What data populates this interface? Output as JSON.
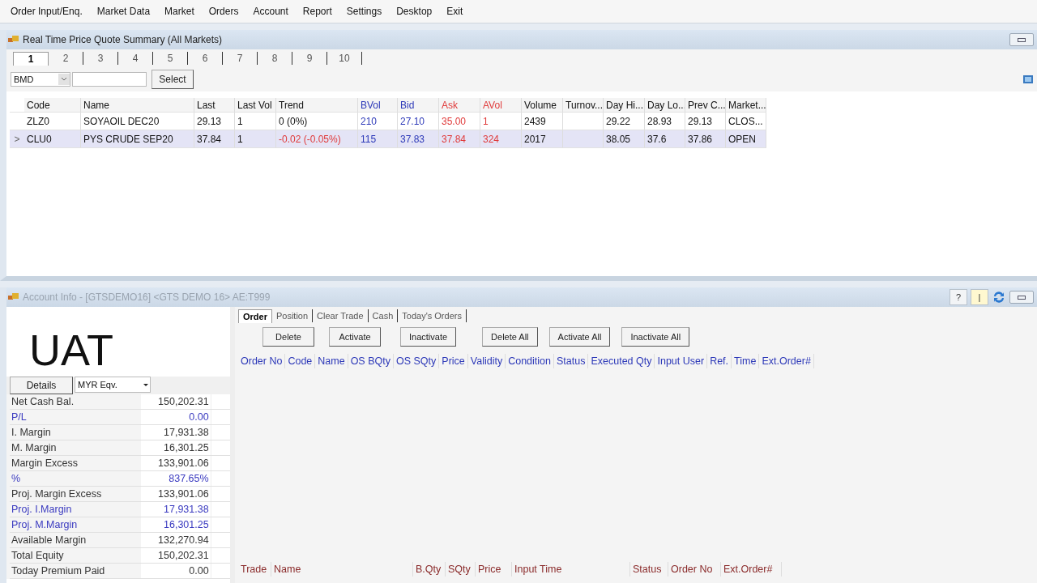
{
  "menu": [
    "Order Input/Enq.",
    "Market Data",
    "Market",
    "Orders",
    "Account",
    "Report",
    "Settings",
    "Desktop",
    "Exit"
  ],
  "quote_window": {
    "title": "Real Time Price Quote Summary (All Markets)",
    "tabs": [
      {
        "label": "1",
        "selected": true
      },
      {
        "label": "2",
        "selected": false
      },
      {
        "label": "3",
        "selected": false
      },
      {
        "label": "4",
        "selected": false
      },
      {
        "label": "5",
        "selected": false
      },
      {
        "label": "6",
        "selected": false
      },
      {
        "label": "7",
        "selected": false
      },
      {
        "label": "8",
        "selected": false
      },
      {
        "label": "9",
        "selected": false
      },
      {
        "label": "10",
        "selected": false
      }
    ],
    "exchange": "BMD",
    "select_button": "Select",
    "columns": [
      {
        "label": "Code",
        "color": "#111111"
      },
      {
        "label": "Name",
        "color": "#111111"
      },
      {
        "label": "Last",
        "color": "#111111"
      },
      {
        "label": "Last Vol",
        "color": "#111111"
      },
      {
        "label": "Trend",
        "color": "#111111"
      },
      {
        "label": "BVol",
        "color": "#2c38b8"
      },
      {
        "label": "Bid",
        "color": "#2c38b8"
      },
      {
        "label": "Ask",
        "color": "#e03a3a"
      },
      {
        "label": "AVol",
        "color": "#e03a3a"
      },
      {
        "label": "Volume",
        "color": "#111111"
      },
      {
        "label": "Turnov...",
        "color": "#111111"
      },
      {
        "label": "Day Hi...",
        "color": "#111111"
      },
      {
        "label": "Day Lo...",
        "color": "#111111"
      },
      {
        "label": "Prev C...",
        "color": "#111111"
      },
      {
        "label": "Market...",
        "color": "#111111"
      }
    ],
    "rows": [
      {
        "selected": false,
        "trend_down": false,
        "cells": [
          "ZLZ0",
          "SOYAOIL DEC20",
          "29.13",
          "1",
          "0 (0%)",
          "210",
          "27.10",
          "35.00",
          "1",
          "2439",
          "",
          "29.22",
          "28.93",
          "29.13",
          "CLOS..."
        ]
      },
      {
        "selected": true,
        "trend_down": true,
        "cells": [
          "CLU0",
          "PYS CRUDE SEP20",
          "37.84",
          "1",
          "-0.02 (-0.05%)",
          "115",
          "37.83",
          "37.84",
          "324",
          "2017",
          "",
          "38.05",
          "37.6",
          "37.86",
          "OPEN"
        ]
      }
    ],
    "row_marker": ">"
  },
  "account_window": {
    "title": "Account Info - [GTSDEMO16] <GTS DEMO 16> AE:T999",
    "title_buttons": [
      "?",
      "|"
    ],
    "banner": "UAT",
    "details_button": "Details",
    "currency": "MYR Eqv.",
    "balances": [
      {
        "label": "Net Cash Bal.",
        "value": "150,202.31",
        "highlight": false
      },
      {
        "label": "P/L",
        "value": "0.00",
        "highlight": true
      },
      {
        "label": "I. Margin",
        "value": "17,931.38",
        "highlight": false
      },
      {
        "label": "M. Margin",
        "value": "16,301.25",
        "highlight": false
      },
      {
        "label": "Margin Excess",
        "value": "133,901.06",
        "highlight": false
      },
      {
        "label": "%",
        "value": "837.65%",
        "highlight": true
      },
      {
        "label": "Proj. Margin Excess",
        "value": "133,901.06",
        "highlight": false
      },
      {
        "label": "Proj. I.Margin",
        "value": "17,931.38",
        "highlight": true
      },
      {
        "label": "Proj. M.Margin",
        "value": "16,301.25",
        "highlight": true
      },
      {
        "label": "Available Margin",
        "value": "132,270.94",
        "highlight": false
      },
      {
        "label": "Total Equity",
        "value": "150,202.31",
        "highlight": false
      },
      {
        "label": "Today Premium Paid",
        "value": "0.00",
        "highlight": false
      }
    ],
    "tabs": [
      {
        "label": "Order",
        "selected": true
      },
      {
        "label": "Position",
        "selected": false
      },
      {
        "label": "Clear Trade",
        "selected": false
      },
      {
        "label": "Cash",
        "selected": false
      },
      {
        "label": "Today's Orders",
        "selected": false
      }
    ],
    "order_buttons": [
      "Delete",
      "Activate",
      "Inactivate",
      "Delete All",
      "Activate All",
      "Inactivate All"
    ],
    "order_columns": [
      "Order No",
      "Code",
      "Name",
      "OS BQty",
      "OS SQty",
      "Price",
      "Validity",
      "Condition",
      "Status",
      "Executed Qty",
      "Input User",
      "Ref.",
      "Time",
      "Ext.Order#"
    ],
    "trade_columns": [
      "Trade",
      "Name",
      "B.Qty",
      "SQty",
      "Price",
      "Input Time",
      "Status",
      "Order No",
      "Ext.Order#"
    ]
  }
}
